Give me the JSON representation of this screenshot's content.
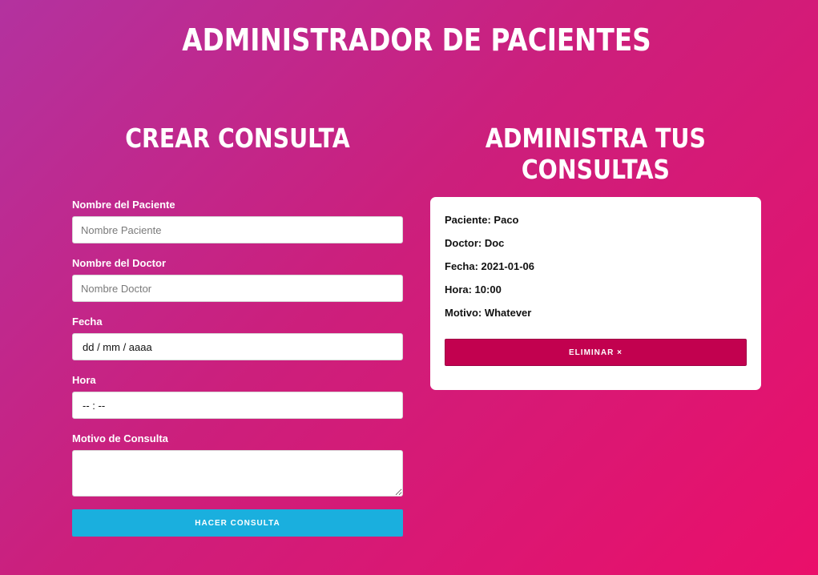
{
  "header": {
    "title": "ADMINISTRADOR DE PACIENTES"
  },
  "form_section": {
    "title": "CREAR CONSULTA",
    "patient": {
      "label": "Nombre del Paciente",
      "placeholder": "Nombre Paciente",
      "value": ""
    },
    "doctor": {
      "label": "Nombre del Doctor",
      "placeholder": "Nombre Doctor",
      "value": ""
    },
    "date": {
      "label": "Fecha",
      "display": "dd / mm / aaaa"
    },
    "time": {
      "label": "Hora",
      "display": "-- : --"
    },
    "reason": {
      "label": "Motivo de Consulta",
      "value": ""
    },
    "submit_label": "HACER CONSULTA"
  },
  "list_section": {
    "title": "ADMINISTRA TUS CONSULTAS",
    "appointments": [
      {
        "patient": "Paciente: Paco",
        "doctor": "Doctor: Doc",
        "date": "Fecha: 2021-01-06",
        "time": "Hora: 10:00",
        "reason": "Motivo: Whatever",
        "delete_label": "ELIMINAR ×"
      }
    ]
  },
  "colors": {
    "background_start": "#b3329f",
    "background_end": "#ea0f6a",
    "submit_button": "#1aafde",
    "delete_button": "#c2014f",
    "card": "#ffffff"
  }
}
